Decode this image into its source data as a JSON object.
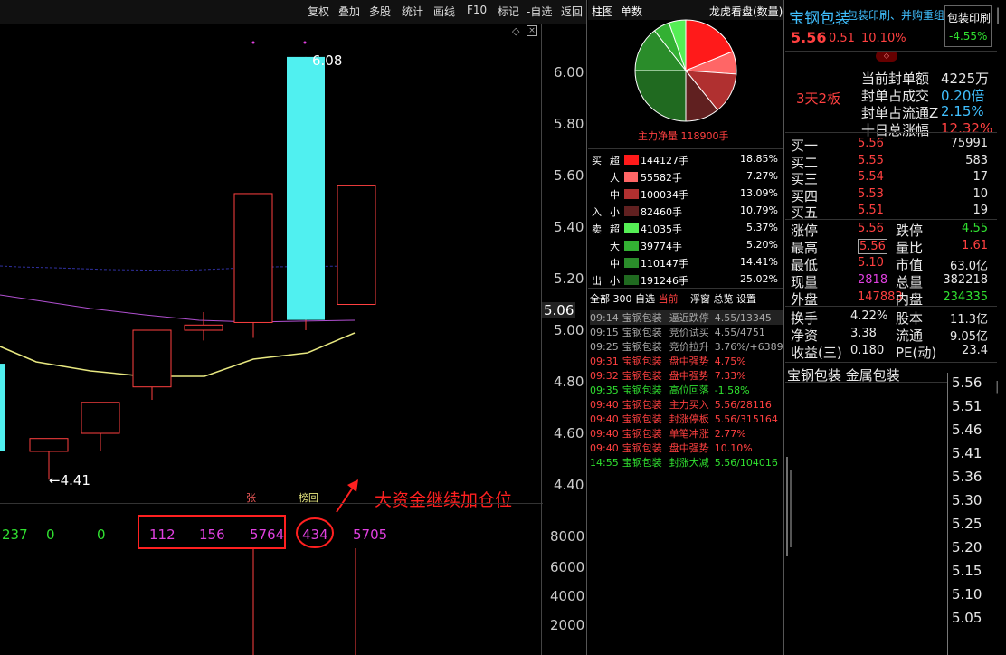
{
  "toolbar": {
    "items": [
      "复权",
      "叠加",
      "多股",
      "统计",
      "画线",
      "F10",
      "标记",
      "-自选",
      "返回"
    ]
  },
  "kline": {
    "price_labels": [
      "6.00",
      "5.80",
      "5.60",
      "5.40",
      "5.20",
      "5.00",
      "4.80",
      "4.60",
      "4.40"
    ],
    "current_price_tag": "5.06",
    "high_label": "6.08",
    "low_label": "←4.41",
    "markers": {
      "zhang": "张",
      "banghui": "榜回"
    },
    "annotation": "大资金继续加仓位",
    "volume_numbers": [
      "237",
      "0",
      "0",
      "112",
      "156",
      "5764",
      "434",
      "5705"
    ],
    "volume_labels": [
      "8000",
      "6000",
      "4000",
      "2000"
    ],
    "candles": [
      {
        "o": 4.87,
        "c": 4.53,
        "h": 4.87,
        "l": 4.53
      },
      {
        "o": 4.53,
        "c": 4.58,
        "h": 4.58,
        "l": 4.42
      },
      {
        "o": 4.6,
        "c": 4.72,
        "h": 4.72,
        "l": 4.53
      },
      {
        "o": 4.78,
        "c": 5.0,
        "h": 5.0,
        "l": 4.73
      },
      {
        "o": 5.0,
        "c": 5.02,
        "h": 5.07,
        "l": 4.96
      },
      {
        "o": 5.03,
        "c": 5.53,
        "h": 5.53,
        "l": 4.97
      },
      {
        "o": 5.04,
        "c": 6.06,
        "h": 6.06,
        "l": 5.0
      },
      {
        "o": 5.1,
        "c": 5.56,
        "h": 5.56,
        "l": 5.1
      }
    ]
  },
  "panel2": {
    "tabs": [
      "柱图",
      "单数"
    ],
    "title": "龙虎看盘(数量)",
    "net_label": "主力净量 118900手",
    "pie": [
      {
        "value": 18.85,
        "color": "#ff1a1a"
      },
      {
        "value": 7.27,
        "color": "#ff6666"
      },
      {
        "value": 13.09,
        "color": "#b03030"
      },
      {
        "value": 10.79,
        "color": "#602020"
      },
      {
        "value": 25.02,
        "color": "#206a20"
      },
      {
        "value": 14.41,
        "color": "#2a8c2a"
      },
      {
        "value": 5.2,
        "color": "#33b033"
      },
      {
        "value": 5.37,
        "color": "#55ee55"
      }
    ],
    "flows": [
      {
        "side": "买",
        "size": "超",
        "value": "144127手",
        "pct": "18.85%",
        "color": "#ff1a1a",
        "bar": 1.0
      },
      {
        "side": "",
        "size": "大",
        "value": "55582手",
        "pct": "7.27%",
        "color": "#ff6666",
        "bar": 0.95
      },
      {
        "side": "",
        "size": "中",
        "value": "100034手",
        "pct": "13.09%",
        "color": "#b03030",
        "bar": 1.0
      },
      {
        "side": "入",
        "size": "小",
        "value": "82460手",
        "pct": "10.79%",
        "color": "#602020",
        "bar": 1.0
      },
      {
        "side": "卖",
        "size": "超",
        "value": "41035手",
        "pct": "5.37%",
        "color": "#55ee55",
        "bar": 1.0
      },
      {
        "side": "",
        "size": "大",
        "value": "39774手",
        "pct": "5.20%",
        "color": "#33b033",
        "bar": 1.0
      },
      {
        "side": "",
        "size": "中",
        "value": "110147手",
        "pct": "14.41%",
        "color": "#2a8c2a",
        "bar": 1.0
      },
      {
        "side": "出",
        "size": "小",
        "value": "191246手",
        "pct": "25.02%",
        "color": "#206a20",
        "bar": 1.0
      }
    ],
    "list_tabs": [
      "全部",
      "300",
      "自选",
      "当前",
      "浮窗",
      "总览",
      "设置"
    ],
    "events": [
      {
        "time": "09:14",
        "name": "宝钢包装",
        "type": "逼近跌停",
        "val": "4.55/13345",
        "color": "#aaaaaa"
      },
      {
        "time": "09:15",
        "name": "宝钢包装",
        "type": "竞价试买",
        "val": "4.55/4751",
        "color": "#aaaaaa"
      },
      {
        "time": "09:25",
        "name": "宝钢包装",
        "type": "竞价拉升",
        "val": "3.76%/+6389",
        "color": "#aaaaaa"
      },
      {
        "time": "09:31",
        "name": "宝钢包装",
        "type": "盘中强势",
        "val": "4.75%",
        "color": "#ff4040"
      },
      {
        "time": "09:32",
        "name": "宝钢包装",
        "type": "盘中强势",
        "val": "7.33%",
        "color": "#ff4040"
      },
      {
        "time": "09:35",
        "name": "宝钢包装",
        "type": "高位回落",
        "val": "-1.58%",
        "color": "#30e030"
      },
      {
        "time": "09:40",
        "name": "宝钢包装",
        "type": "主力买入",
        "val": "5.56/28116",
        "color": "#ff4040"
      },
      {
        "time": "09:40",
        "name": "宝钢包装",
        "type": "封涨停板",
        "val": "5.56/315164",
        "color": "#ff4040"
      },
      {
        "time": "09:40",
        "name": "宝钢包装",
        "type": "单笔冲涨",
        "val": "2.77%",
        "color": "#ff4040"
      },
      {
        "time": "09:40",
        "name": "宝钢包装",
        "type": "盘中强势",
        "val": "10.10%",
        "color": "#ff4040"
      },
      {
        "time": "14:55",
        "name": "宝钢包装",
        "type": "封涨大减",
        "val": "5.56/104016",
        "color": "#30e030"
      }
    ]
  },
  "panel3": {
    "stock_name": "宝钢包装",
    "concepts": "包装印刷、并购重组",
    "sector_box": "包装印刷",
    "sector_change": "-4.55%",
    "price": "5.56",
    "change": "0.51",
    "pct": "10.10%",
    "board": "3天2板",
    "seal": [
      {
        "label": "当前封单额",
        "value": "4225万",
        "color": "#e8e8e8"
      },
      {
        "label": "封单占成交",
        "value": "0.20倍",
        "color": "#40c0ff"
      },
      {
        "label": "封单占流通Z",
        "value": "2.15%",
        "color": "#40c0ff"
      },
      {
        "label": "十日总涨幅",
        "value": "12.32%",
        "color": "#ff4040"
      }
    ],
    "bids": [
      {
        "label": "买一",
        "price": "5.56",
        "vol": "75991"
      },
      {
        "label": "买二",
        "price": "5.55",
        "vol": "583"
      },
      {
        "label": "买三",
        "price": "5.54",
        "vol": "17"
      },
      {
        "label": "买四",
        "price": "5.53",
        "vol": "10"
      },
      {
        "label": "买五",
        "price": "5.51",
        "vol": "19"
      }
    ],
    "stats": [
      {
        "l1": "涨停",
        "v1": "5.56",
        "c1": "#ff4040",
        "l2": "跌停",
        "v2": "4.55",
        "c2": "#30e030"
      },
      {
        "l1": "最高",
        "v1": "5.56",
        "c1": "#ff4040",
        "l2": "量比",
        "v2": "1.61",
        "c2": "#ff4040"
      },
      {
        "l1": "最低",
        "v1": "5.10",
        "c1": "#ff4040",
        "l2": "市值",
        "v2": "63.0亿",
        "c2": "#e8e8e8"
      },
      {
        "l1": "现量",
        "v1": "2818",
        "c1": "#e040e0",
        "l2": "总量",
        "v2": "382218",
        "c2": "#e8e8e8"
      },
      {
        "l1": "外盘",
        "v1": "147883",
        "c1": "#ff4040",
        "l2": "内盘",
        "v2": "234335",
        "c2": "#30e030"
      }
    ],
    "stats2": [
      {
        "l1": "换手",
        "v1": "4.22%",
        "l2": "股本",
        "v2": "11.3亿"
      },
      {
        "l1": "净资",
        "v1": "3.38",
        "l2": "流通",
        "v2": "9.05亿"
      },
      {
        "l1": "收益(三)",
        "v1": "0.180",
        "l2": "PE(动)",
        "v2": "23.4"
      }
    ],
    "mini_title": "宝钢包装  金属包装",
    "mini_prices": [
      "5.56",
      "5.51",
      "5.46",
      "5.41",
      "5.36",
      "5.30",
      "5.25",
      "5.20",
      "5.15",
      "5.10",
      "5.05"
    ]
  }
}
